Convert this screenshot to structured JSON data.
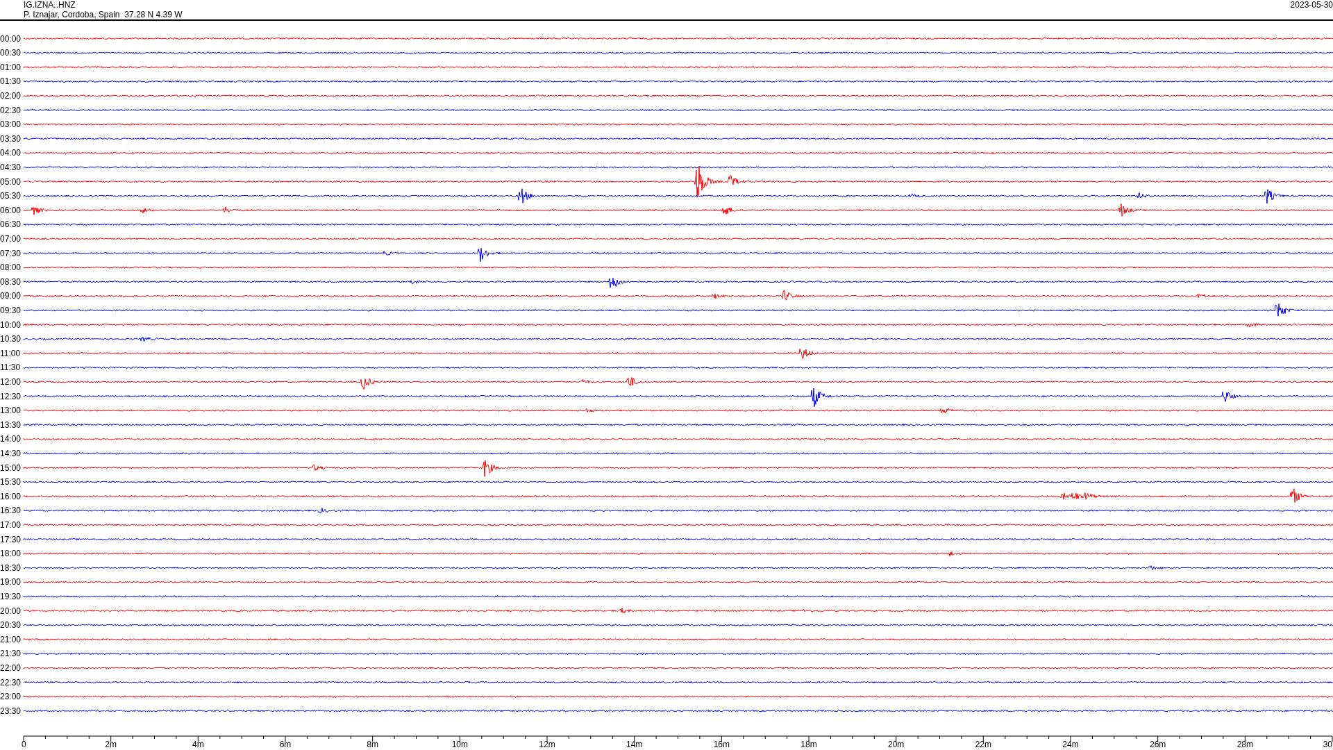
{
  "header": {
    "title": "IG.IZNA..HNZ",
    "location": "P. Iznajar, Cordoba, Spain  37.28 N 4.39 W",
    "date": "2023-05-30"
  },
  "rows": [
    {
      "label": "00:00",
      "color": "#ff0000"
    },
    {
      "label": "00:30",
      "color": "#0000ff"
    },
    {
      "label": "01:00",
      "color": "#ff0000"
    },
    {
      "label": "01:30",
      "color": "#0000ff"
    },
    {
      "label": "02:00",
      "color": "#ff0000"
    },
    {
      "label": "02:30",
      "color": "#0000ff"
    },
    {
      "label": "03:00",
      "color": "#ff0000"
    },
    {
      "label": "03:30",
      "color": "#0000ff"
    },
    {
      "label": "04:00",
      "color": "#ff0000"
    },
    {
      "label": "04:30",
      "color": "#0000ff"
    },
    {
      "label": "05:00",
      "color": "#ff0000"
    },
    {
      "label": "05:30",
      "color": "#0000ff"
    },
    {
      "label": "06:00",
      "color": "#ff0000"
    },
    {
      "label": "06:30",
      "color": "#0000ff"
    },
    {
      "label": "07:00",
      "color": "#ff0000"
    },
    {
      "label": "07:30",
      "color": "#0000ff"
    },
    {
      "label": "08:00",
      "color": "#ff0000"
    },
    {
      "label": "08:30",
      "color": "#0000ff"
    },
    {
      "label": "09:00",
      "color": "#ff0000"
    },
    {
      "label": "09:30",
      "color": "#0000ff"
    },
    {
      "label": "10:00",
      "color": "#ff0000"
    },
    {
      "label": "10:30",
      "color": "#0000ff"
    },
    {
      "label": "11:00",
      "color": "#ff0000"
    },
    {
      "label": "11:30",
      "color": "#0000ff"
    },
    {
      "label": "12:00",
      "color": "#ff0000"
    },
    {
      "label": "12:30",
      "color": "#0000ff"
    },
    {
      "label": "13:00",
      "color": "#ff0000"
    },
    {
      "label": "13:30",
      "color": "#0000ff"
    },
    {
      "label": "14:00",
      "color": "#ff0000"
    },
    {
      "label": "14:30",
      "color": "#0000ff"
    },
    {
      "label": "15:00",
      "color": "#ff0000"
    },
    {
      "label": "15:30",
      "color": "#0000ff"
    },
    {
      "label": "16:00",
      "color": "#ff0000"
    },
    {
      "label": "16:30",
      "color": "#0000ff"
    },
    {
      "label": "17:00",
      "color": "#ff0000"
    },
    {
      "label": "17:30",
      "color": "#0000ff"
    },
    {
      "label": "18:00",
      "color": "#ff0000"
    },
    {
      "label": "18:30",
      "color": "#0000ff"
    },
    {
      "label": "19:00",
      "color": "#ff0000"
    },
    {
      "label": "19:30",
      "color": "#0000ff"
    },
    {
      "label": "20:00",
      "color": "#ff0000"
    },
    {
      "label": "20:30",
      "color": "#0000ff"
    },
    {
      "label": "21:00",
      "color": "#ff0000"
    },
    {
      "label": "21:30",
      "color": "#0000ff"
    },
    {
      "label": "22:00",
      "color": "#ff0000"
    },
    {
      "label": "22:30",
      "color": "#0000ff"
    },
    {
      "label": "23:00",
      "color": "#ff0000"
    },
    {
      "label": "23:30",
      "color": "#0000ff"
    }
  ],
  "x_axis": {
    "ticks": [
      "0",
      "2m",
      "4m",
      "6m",
      "8m",
      "10m",
      "12m",
      "14m",
      "16m",
      "18m",
      "20m",
      "22m",
      "24m",
      "26m",
      "28m",
      "30"
    ]
  }
}
